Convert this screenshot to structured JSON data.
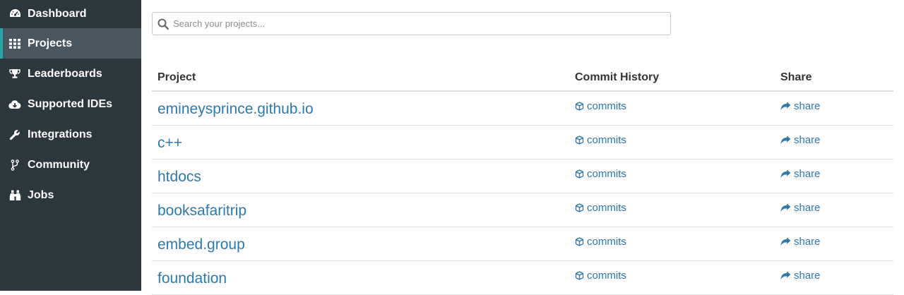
{
  "sidebar": {
    "items": [
      {
        "label": "Dashboard",
        "icon": "dashboard-icon",
        "active": false
      },
      {
        "label": "Projects",
        "icon": "grid-icon",
        "active": true
      },
      {
        "label": "Leaderboards",
        "icon": "trophy-icon",
        "active": false
      },
      {
        "label": "Supported IDEs",
        "icon": "cloud-download-icon",
        "active": false
      },
      {
        "label": "Integrations",
        "icon": "wrench-icon",
        "active": false
      },
      {
        "label": "Community",
        "icon": "code-fork-icon",
        "active": false
      },
      {
        "label": "Jobs",
        "icon": "binoculars-icon",
        "active": false
      }
    ],
    "colors": {
      "background": "#2c363d",
      "active_background": "#4a5761",
      "active_accent": "#2fa4a0"
    }
  },
  "search": {
    "placeholder": "Search your projects...",
    "value": ""
  },
  "table": {
    "headers": {
      "project": "Project",
      "commits": "Commit History",
      "share": "Share"
    },
    "rows": [
      {
        "project": "emineysprince.github.io",
        "commits": "commits",
        "share": "share"
      },
      {
        "project": "c++",
        "commits": "commits",
        "share": "share"
      },
      {
        "project": "htdocs",
        "commits": "commits",
        "share": "share"
      },
      {
        "project": "booksafaritrip",
        "commits": "commits",
        "share": "share"
      },
      {
        "project": "embed.group",
        "commits": "commits",
        "share": "share"
      },
      {
        "project": "foundation",
        "commits": "commits",
        "share": "share"
      }
    ],
    "link_color": "#2a7ab0"
  }
}
